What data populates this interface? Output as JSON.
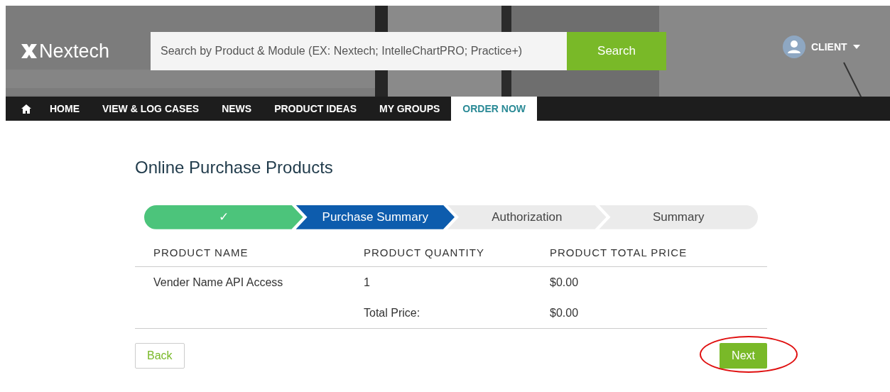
{
  "header": {
    "logo": "Nextech",
    "search": {
      "placeholder": "Search by Product & Module (EX: Nextech; IntelleChartPRO; Practice+)",
      "button": "Search"
    },
    "user_menu": {
      "label": "CLIENT"
    }
  },
  "nav": [
    {
      "label": "HOME",
      "selected": false
    },
    {
      "label": "VIEW & LOG CASES",
      "selected": false
    },
    {
      "label": "NEWS",
      "selected": false
    },
    {
      "label": "PRODUCT IDEAS",
      "selected": false
    },
    {
      "label": "MY GROUPS",
      "selected": false
    },
    {
      "label": "ORDER NOW",
      "selected": true
    }
  ],
  "page_title": "Online Purchase Products",
  "steps": [
    {
      "label": "✓",
      "completed": true,
      "selected": false
    },
    {
      "label": "Purchase Summary",
      "completed": false,
      "selected": true
    },
    {
      "label": "Authorization",
      "completed": false,
      "selected": false
    },
    {
      "label": "Summary",
      "completed": false,
      "selected": false
    }
  ],
  "table": {
    "columns": [
      "PRODUCT NAME",
      "PRODUCT QUANTITY",
      "PRODUCT TOTAL PRICE"
    ],
    "rows": [
      [
        "Vender Name API Access",
        "1",
        "$0.00"
      ]
    ],
    "total": {
      "label": "Total Price:",
      "value": "$0.00"
    }
  },
  "back_button": "Back",
  "next_button": {
    "label": "Next",
    "circled": true
  }
}
